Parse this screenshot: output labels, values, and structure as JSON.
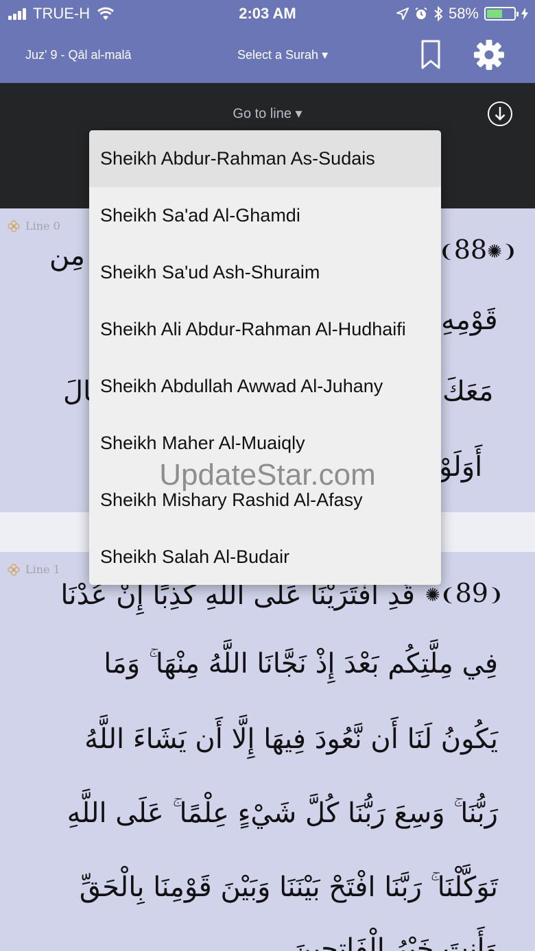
{
  "status_bar": {
    "carrier": "TRUE-H",
    "time": "2:03 AM",
    "battery_percent": "58%",
    "battery_level": 0.58,
    "icons": [
      "signal-icon",
      "wifi-icon",
      "location-icon",
      "alarm-icon",
      "bluetooth-icon",
      "battery-icon",
      "charging-icon"
    ]
  },
  "nav": {
    "juz_label": "Juz' 9 - Qāl al-malā",
    "surah_select": "Select a Surah ▾",
    "icons": [
      "bookmark-icon",
      "gear-icon"
    ]
  },
  "toolbar": {
    "goto_line": "Go to line ▾",
    "icons": [
      "download-icon"
    ]
  },
  "verses": [
    {
      "line_label": "Line 0",
      "ayah_number": "88",
      "text_lines": [
        "مِن",
        "قَوْمِهِ",
        "مَعَكَ",
        "قَالَ",
        "أَوَلَوْ"
      ]
    },
    {
      "line_label": "Line 1",
      "ayah_number": "89",
      "text_lines": [
        "قَدِ افْتَرَيْنَا عَلَى اللَّهِ كَذِبًا إِنْ عُدْنَا",
        "فِي مِلَّتِكُم بَعْدَ إِذْ نَجَّانَا اللَّهُ مِنْهَا ۚ وَمَا",
        "يَكُونُ لَنَا أَن نَّعُودَ فِيهَا إِلَّا أَن يَشَاءَ اللَّهُ",
        "رَبُّنَا ۚ وَسِعَ رَبُّنَا كُلَّ شَيْءٍ عِلْمًا ۚ عَلَى اللَّهِ",
        "تَوَكَّلْنَا ۚ رَبَّنَا افْتَحْ بَيْنَنَا وَبَيْنَ قَوْمِنَا بِالْحَقِّ",
        "وَأَنتَ خَيْرُ الْفَاتِحِينَ"
      ]
    }
  ],
  "reciter_dropdown": {
    "selected_index": 0,
    "items": [
      "Sheikh Abdur-Rahman As-Sudais",
      "Sheikh Sa'ad Al-Ghamdi",
      "Sheikh Sa'ud Ash-Shuraim",
      "Sheikh Ali Abdur-Rahman Al-Hudhaifi",
      "Sheikh Abdullah Awwad Al-Juhany",
      "Sheikh Maher Al-Muaiqly",
      "Sheikh Mishary Rashid Al-Afasy",
      "Sheikh Salah Al-Budair"
    ]
  },
  "watermark": "UpdateStar.com",
  "colors": {
    "nav_bg": "#6b76b6",
    "toolbar_bg": "#232527",
    "verse_bg": "#d0d3ea",
    "dropdown_bg": "#efeff0",
    "selected_item_bg": "#e1e1e2",
    "battery_fill": "#7be07b"
  }
}
